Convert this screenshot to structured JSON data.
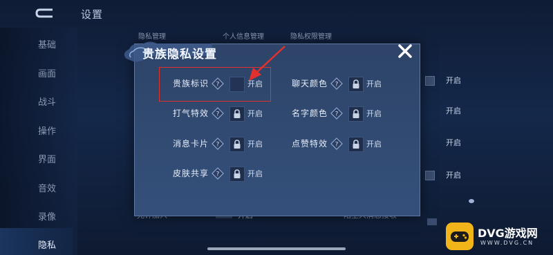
{
  "background": {
    "title": "设置",
    "nav": [
      "基础",
      "画面",
      "战斗",
      "操作",
      "界面",
      "音效",
      "录像",
      "隐私"
    ],
    "active_nav": "隐私",
    "tabs": [
      "隐私管理",
      "个人信息管理",
      "隐私权限管理"
    ],
    "right_states": [
      "开启",
      "开启",
      "开启",
      "开启",
      "开启"
    ],
    "bottom_left_label": "允许加入",
    "bottom_left_state": "开启",
    "bottom_right_label": "陌生人消息接收"
  },
  "modal": {
    "title": "贵族隐私设置",
    "settings": [
      {
        "label": "贵族标识",
        "state": "开启",
        "locked": false,
        "help_icon": "help-diamond-icon"
      },
      {
        "label": "聊天颜色",
        "state": "开启",
        "locked": true,
        "help_icon": "help-diamond-icon"
      },
      {
        "label": "打气特效",
        "state": "开启",
        "locked": true,
        "help_icon": "help-diamond-icon"
      },
      {
        "label": "名字颜色",
        "state": "开启",
        "locked": true,
        "help_icon": "help-diamond-icon"
      },
      {
        "label": "消息卡片",
        "state": "开启",
        "locked": true,
        "help_icon": "help-diamond-icon"
      },
      {
        "label": "点赞特效",
        "state": "开启",
        "locked": true,
        "help_icon": "help-diamond-icon"
      },
      {
        "label": "皮肤共享",
        "state": "开启",
        "locked": true,
        "help_icon": "help-diamond-icon"
      }
    ]
  },
  "annotation": {
    "highlight_color": "#e2302f"
  },
  "watermark": {
    "text": "DVG游戏网",
    "url": "WWW.DVG.CN"
  },
  "colors": {
    "modal_bg": "#34507a",
    "accent": "#5f7aa5",
    "watermark": "#f1b51a"
  }
}
